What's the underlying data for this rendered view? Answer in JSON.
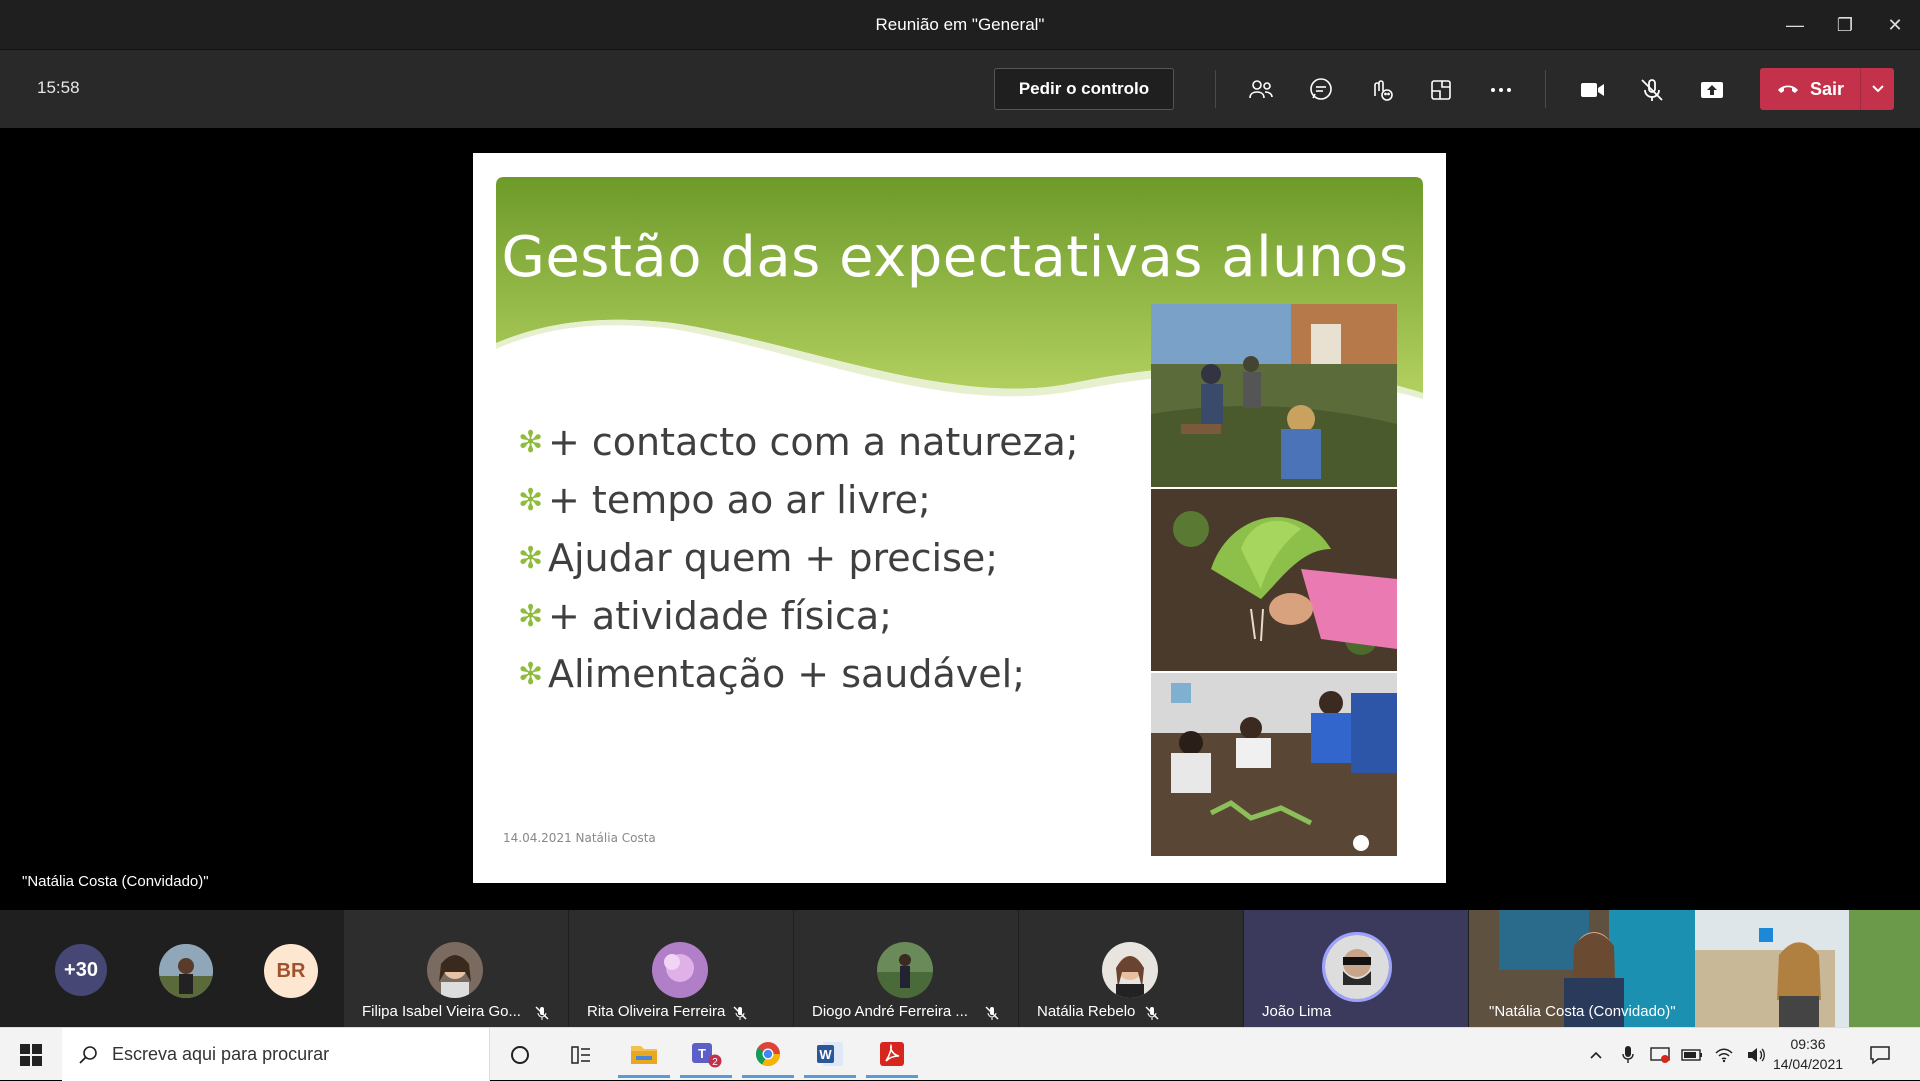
{
  "window": {
    "title": "Reunião em \"General\""
  },
  "toolbar": {
    "clock": "15:58",
    "request_control_label": "Pedir o controlo",
    "leave_label": "Sair",
    "leave_color": "#c4314b"
  },
  "slide": {
    "title": "Gestão das expectativas alunos",
    "bullets": [
      "+ contacto com a natureza;",
      "+ tempo ao ar livre;",
      "Ajudar quem + precise;",
      "+ atividade física;",
      "Alimentação + saudável;"
    ],
    "footer": "14.04.2021 Natália Costa",
    "accent_color": "#8fbc3c"
  },
  "presenter_label": "\"Natália Costa (Convidado)\"",
  "participants": {
    "overflow_count": "+30",
    "initials": "BR",
    "tiles": [
      {
        "name": "Filipa Isabel Vieira Go..."
      },
      {
        "name": "Rita Oliveira Ferreira"
      },
      {
        "name": "Diogo André Ferreira ..."
      },
      {
        "name": "Natália Rebelo"
      },
      {
        "name": "João Lima"
      }
    ],
    "self_label": "\"Natália Costa (Convidado)\""
  },
  "taskbar": {
    "search_placeholder": "Escreva aqui para procurar",
    "teams_badge": "2",
    "time": "09:36",
    "date": "14/04/2021"
  }
}
